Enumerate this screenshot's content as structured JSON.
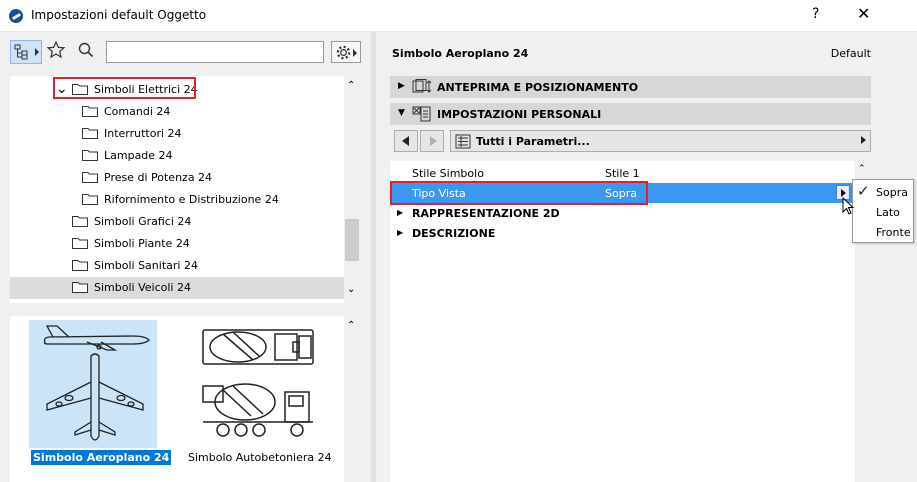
{
  "window": {
    "title": "Impostazioni default Oggetto",
    "help_label": "?",
    "close_label": "✕"
  },
  "toolbar": {
    "search_value": ""
  },
  "tree": {
    "items": [
      {
        "label": "Simboli Elettrici 24",
        "level": 0,
        "expanded": true,
        "highlighted": true
      },
      {
        "label": "Comandi 24",
        "level": 1
      },
      {
        "label": "Interruttori 24",
        "level": 1
      },
      {
        "label": "Lampade 24",
        "level": 1
      },
      {
        "label": "Prese di Potenza 24",
        "level": 1
      },
      {
        "label": "Rifornimento e Distribuzione 24",
        "level": 1
      },
      {
        "label": "Simboli Grafici 24",
        "level": 0
      },
      {
        "label": "Simboli Piante 24",
        "level": 0
      },
      {
        "label": "Simboli Sanitari 24",
        "level": 0
      },
      {
        "label": "Simboli Veicoli 24",
        "level": 0,
        "selected": true
      }
    ],
    "expand_glyph": "⌄",
    "scroll_up": "⌃",
    "scroll_down": "⌄"
  },
  "preview": {
    "items": [
      {
        "label": "Simbolo Aeroplano 24",
        "selected": true,
        "icon": "airplane-icon"
      },
      {
        "label": "Simbolo Autobetoniera 24",
        "selected": false,
        "icon": "concrete-mixer-truck-icon"
      }
    ],
    "scroll_up": "⌃"
  },
  "right": {
    "object_title": "Simbolo Aeroplano 24",
    "default_label": "Default",
    "sections": [
      {
        "label": "ANTEPRIMA E POSIZIONAMENTO",
        "expanded": false,
        "icon": "preview-position-icon"
      },
      {
        "label": "IMPOSTAZIONI PERSONALI",
        "expanded": true,
        "icon": "custom-settings-icon"
      }
    ],
    "page_select_label": "Tutti i Parametri...",
    "params": [
      {
        "name": "Stile Simbolo",
        "value": "Stile 1"
      },
      {
        "name": "Tipo Vista",
        "value": "Sopra",
        "selected": true
      },
      {
        "name": "RAPPRESENTAZIONE 2D",
        "value": "",
        "group": true
      },
      {
        "name": "DESCRIZIONE",
        "value": "",
        "group": true
      }
    ],
    "scroll_up": "⌃"
  },
  "popup": {
    "options": [
      "Sopra",
      "Lato",
      "Fronte"
    ],
    "selected": "Sopra",
    "check_glyph": "✓"
  },
  "colors": {
    "highlight_box": "#e0232a",
    "selection_blue": "#3b97f2",
    "preview_selection": "#cce4f7"
  }
}
